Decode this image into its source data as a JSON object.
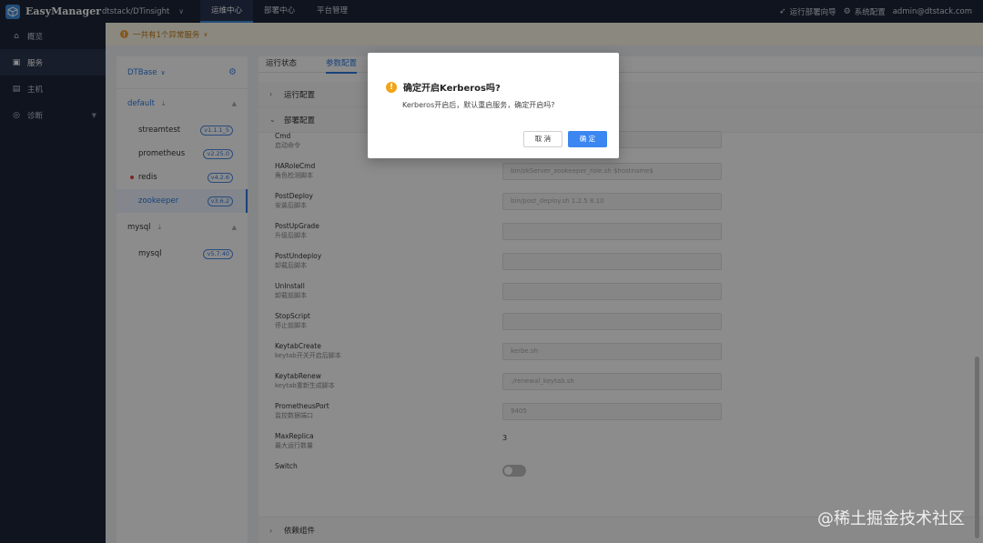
{
  "app": {
    "logo_text": "EasyManager",
    "cluster": "dtstack/DTinsight"
  },
  "topnav": [
    "运维中心",
    "部署中心",
    "平台管理"
  ],
  "topright": {
    "deploy_guide": "运行部署向导",
    "system_config": "系统配置",
    "user": "admin@dtstack.com"
  },
  "sidebar": [
    {
      "label": "概览",
      "icon": "home-icon"
    },
    {
      "label": "服务",
      "icon": "service-icon"
    },
    {
      "label": "主机",
      "icon": "host-icon"
    },
    {
      "label": "诊断",
      "icon": "diagnose-icon"
    }
  ],
  "notice": {
    "text": "一共有1个异常服务"
  },
  "tree": {
    "product": "DTBase",
    "groups": [
      {
        "name": "default",
        "services": [
          {
            "name": "streamtest",
            "version": "v1.1.1_5"
          },
          {
            "name": "prometheus",
            "version": "v2.25.0"
          },
          {
            "name": "redis",
            "version": "v4.2.6"
          },
          {
            "name": "zookeeper",
            "version": "v3.6.2"
          }
        ]
      },
      {
        "name": "mysql",
        "services": [
          {
            "name": "mysql",
            "version": "v5.7.40"
          }
        ]
      }
    ]
  },
  "tabs": [
    "运行状态",
    "参数配置"
  ],
  "sections": {
    "run_config": "运行配置",
    "deploy_config": "部署配置",
    "dependencies": "依赖组件"
  },
  "fields": [
    {
      "name": "Cmd",
      "desc": "启动命令",
      "value": ""
    },
    {
      "name": "HARoleCmd",
      "desc": "角色检测脚本",
      "value": "bin/zkServer_zookeeper_role.sh $hostname$"
    },
    {
      "name": "PostDeploy",
      "desc": "安装后脚本",
      "value": "bin/post_deploy.sh 1.2.5 8.10"
    },
    {
      "name": "PostUpGrade",
      "desc": "升级后脚本",
      "value": ""
    },
    {
      "name": "PostUndeploy",
      "desc": "卸载后脚本",
      "value": ""
    },
    {
      "name": "UnInstall",
      "desc": "卸载前脚本",
      "value": ""
    },
    {
      "name": "StopScript",
      "desc": "停止前脚本",
      "value": ""
    },
    {
      "name": "KeytabCreate",
      "desc": "keytab开关开启后脚本",
      "value": "kerbe.sh"
    },
    {
      "name": "KeytabRenew",
      "desc": "keytab重新生成脚本",
      "value": "./renewal_keytab.sh"
    },
    {
      "name": "PrometheusPort",
      "desc": "监控数据端口",
      "value": "9405"
    }
  ],
  "max_replicas": {
    "name": "MaxReplica",
    "desc": "最大运行数量",
    "value": "3"
  },
  "switch_field": {
    "name": "Switch"
  },
  "modal": {
    "title": "确定开启Kerberos吗?",
    "text": "Kerberos开启后，默认重启服务，确定开启吗?",
    "cancel": "取 消",
    "ok": "确 定"
  },
  "watermark": "@稀土掘金技术社区",
  "colors": {
    "accent": "#3b86f0",
    "warning": "#f4a316",
    "nav_bg": "#1d2538"
  }
}
